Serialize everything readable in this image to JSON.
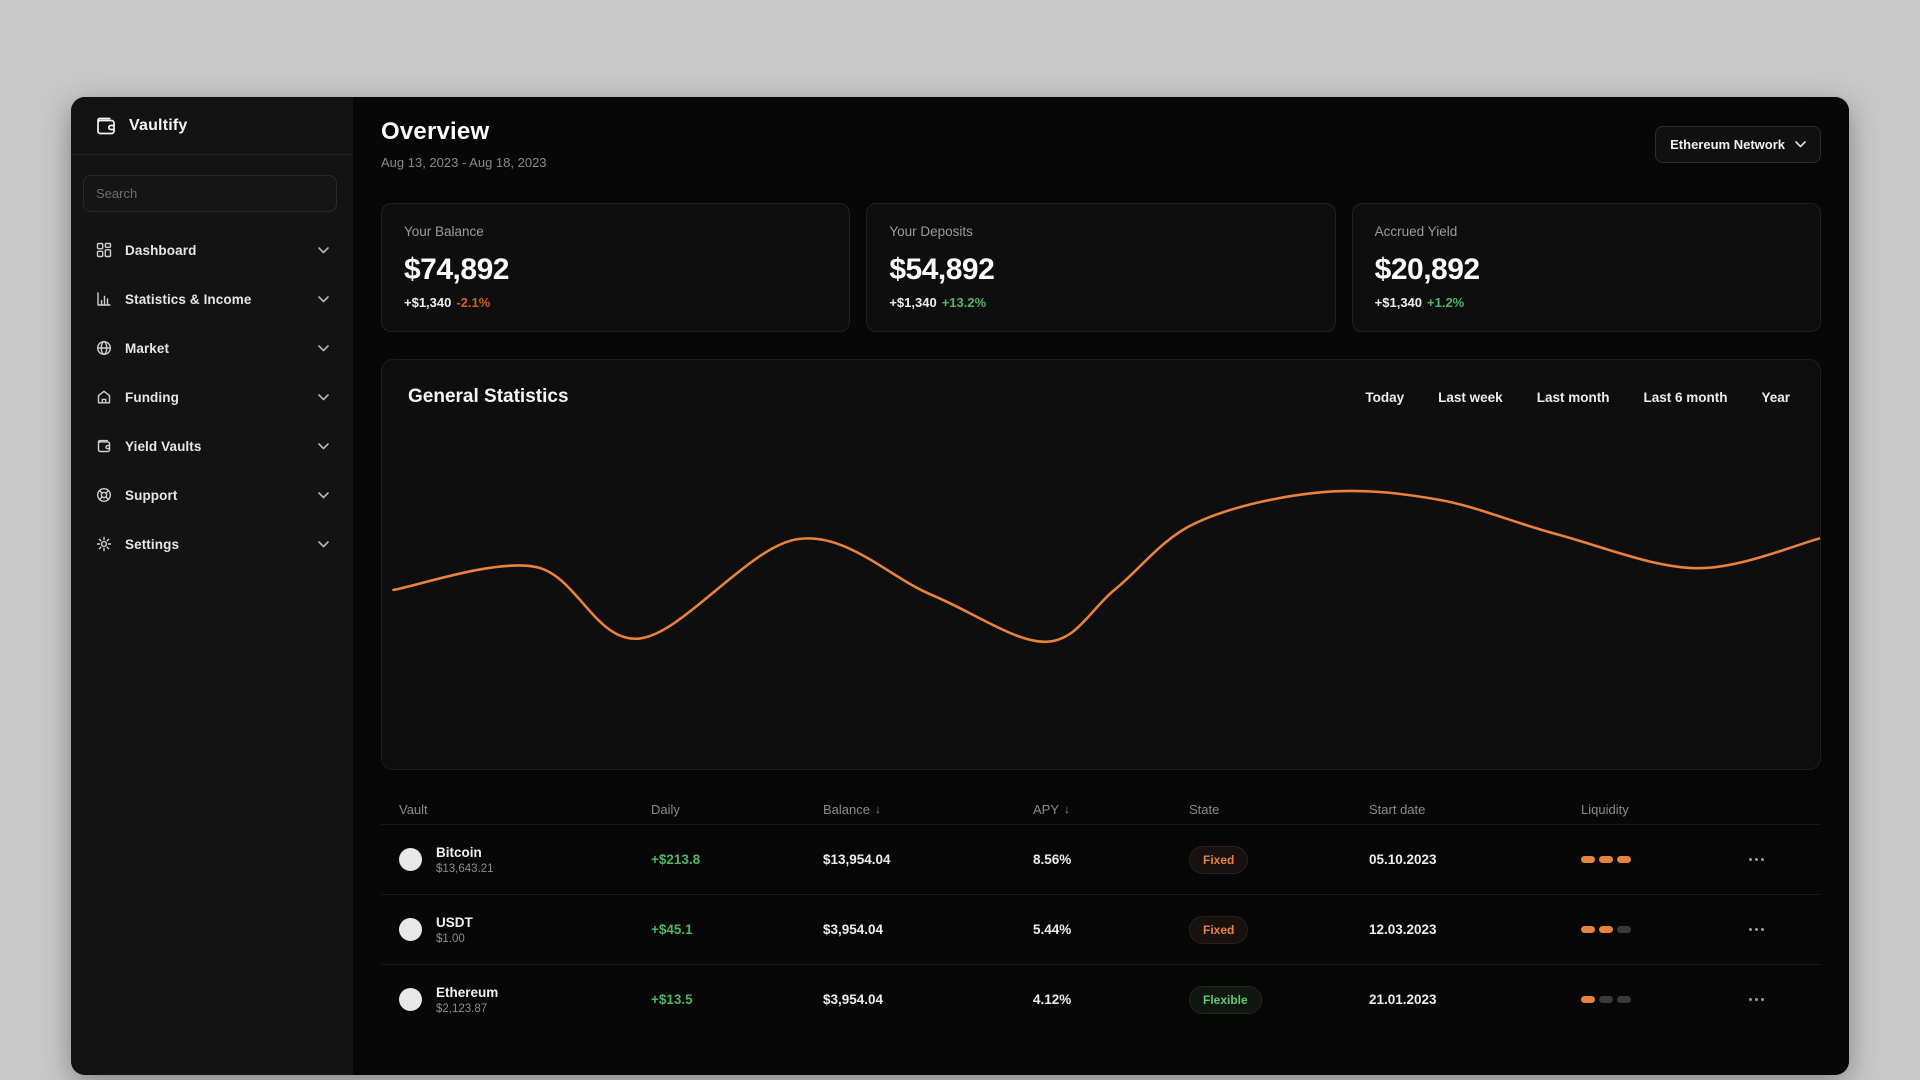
{
  "app": {
    "name": "Vaultify"
  },
  "sidebar": {
    "search_placeholder": "Search",
    "items": [
      {
        "label": "Dashboard",
        "icon": "dashboard-icon",
        "has_chevron": false
      },
      {
        "label": "Statistics & Income",
        "icon": "statistics-icon",
        "has_chevron": false
      },
      {
        "label": "Market",
        "icon": "globe-icon",
        "has_chevron": false
      },
      {
        "label": "Funding",
        "icon": "funding-icon",
        "has_chevron": false
      },
      {
        "label": "Yield Vaults",
        "icon": "vault-icon",
        "has_chevron": true
      },
      {
        "label": "Support",
        "icon": "support-icon",
        "has_chevron": false
      },
      {
        "label": "Settings",
        "icon": "settings-icon",
        "has_chevron": false
      }
    ]
  },
  "header": {
    "title": "Overview",
    "date_range": "Aug 13, 2023 - Aug 18, 2023",
    "network_selector": "Ethereum Network"
  },
  "stat_cards": [
    {
      "label": "Your Balance",
      "value": "$74,892",
      "delta": "+$1,340",
      "percent": "-2.1%",
      "direction": "down"
    },
    {
      "label": "Your Deposits",
      "value": "$54,892",
      "delta": "+$1,340",
      "percent": "+13.2%",
      "direction": "up"
    },
    {
      "label": "Accrued Yield",
      "value": "$20,892",
      "delta": "+$1,340",
      "percent": "+1.2%",
      "direction": "up"
    }
  ],
  "statistics_panel": {
    "title": "General Statistics",
    "ranges": [
      "Today",
      "Last week",
      "Last month",
      "Last 6 month",
      "Year"
    ]
  },
  "chart_data": {
    "type": "line",
    "title": "General Statistics",
    "legend": [],
    "grid": false,
    "axes_labeled": false,
    "line_color": "#e8823c",
    "note": "unlabeled sparkline; points are [x_percent_of_width, y_percent_from_top]",
    "points": [
      [
        0.8,
        56.2
      ],
      [
        10.7,
        50.6
      ],
      [
        17.9,
        68.1
      ],
      [
        28.9,
        43.8
      ],
      [
        38.2,
        57.4
      ],
      [
        46.2,
        68.9
      ],
      [
        51.0,
        56.0
      ],
      [
        56.5,
        40.0
      ],
      [
        65.1,
        32.4
      ],
      [
        73.4,
        34.1
      ],
      [
        81.7,
        42.6
      ],
      [
        91.4,
        50.9
      ],
      [
        100.0,
        43.6
      ]
    ]
  },
  "table": {
    "columns": [
      {
        "label": "Vault",
        "sortable": false
      },
      {
        "label": "Daily",
        "sortable": false
      },
      {
        "label": "Balance",
        "sortable": true,
        "sort_icon": "↓"
      },
      {
        "label": "APY",
        "sortable": true,
        "sort_icon": "↓"
      },
      {
        "label": "State",
        "sortable": false
      },
      {
        "label": "Start date",
        "sortable": false
      },
      {
        "label": "Liquidity",
        "sortable": false
      }
    ],
    "rows": [
      {
        "name": "Bitcoin",
        "price": "$13,643.21",
        "daily": "+$213.8",
        "balance": "$13,954.04",
        "apy": "8.56%",
        "state": "Fixed",
        "state_type": "fixed",
        "start_date": "05.10.2023",
        "liquidity_level": 3,
        "liquidity_max": 3
      },
      {
        "name": "USDT",
        "price": "$1.00",
        "daily": "+$45.1",
        "balance": "$3,954.04",
        "apy": "5.44%",
        "state": "Fixed",
        "state_type": "fixed",
        "start_date": "12.03.2023",
        "liquidity_level": 2,
        "liquidity_max": 3
      },
      {
        "name": "Ethereum",
        "price": "$2,123.87",
        "daily": "+$13.5",
        "balance": "$3,954.04",
        "apy": "4.12%",
        "state": "Flexible",
        "state_type": "flexible",
        "start_date": "21.01.2023",
        "liquidity_level": 1,
        "liquidity_max": 3
      }
    ]
  },
  "colors": {
    "accent_orange": "#e8823c",
    "positive_green": "#53b365",
    "negative_orange": "#d35f24",
    "window_bg": "#070707",
    "sidebar_bg": "#131313"
  }
}
